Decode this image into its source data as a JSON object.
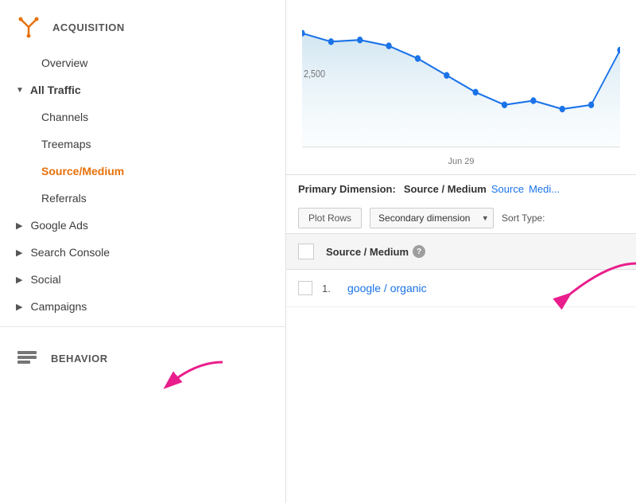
{
  "sidebar": {
    "acquisition_title": "ACQUISITION",
    "items": [
      {
        "id": "overview",
        "label": "Overview",
        "indent": "deep",
        "type": "plain"
      },
      {
        "id": "all-traffic",
        "label": "All Traffic",
        "indent": "medium",
        "type": "subheader",
        "expanded": true
      },
      {
        "id": "channels",
        "label": "Channels",
        "indent": "deep",
        "type": "plain"
      },
      {
        "id": "treemaps",
        "label": "Treemaps",
        "indent": "deep",
        "type": "plain"
      },
      {
        "id": "source-medium",
        "label": "Source/Medium",
        "indent": "deep",
        "type": "active"
      },
      {
        "id": "referrals",
        "label": "Referrals",
        "indent": "deep",
        "type": "plain"
      },
      {
        "id": "google-ads",
        "label": "Google Ads",
        "indent": "medium",
        "type": "expandable"
      },
      {
        "id": "search-console",
        "label": "Search Console",
        "indent": "medium",
        "type": "expandable"
      },
      {
        "id": "social",
        "label": "Social",
        "indent": "medium",
        "type": "expandable"
      },
      {
        "id": "campaigns",
        "label": "Campaigns",
        "indent": "medium",
        "type": "expandable"
      }
    ],
    "behavior_title": "BEHAVIOR"
  },
  "chart": {
    "y_label": "2,500",
    "x_label": "Jun 29"
  },
  "primary_dimension": {
    "label": "Primary Dimension:",
    "options": [
      {
        "id": "source-medium",
        "text": "Source / Medium",
        "selected": true
      },
      {
        "id": "source",
        "text": "Source",
        "selected": false
      },
      {
        "id": "medium",
        "text": "Medi...",
        "selected": false
      }
    ]
  },
  "toolbar": {
    "plot_rows_label": "Plot Rows",
    "secondary_dim_label": "Secondary dimension",
    "sort_type_label": "Sort Type:"
  },
  "table": {
    "header": {
      "column1": "Source / Medium",
      "help_tooltip": "?"
    },
    "rows": [
      {
        "number": "1.",
        "link_text": "google / organic"
      }
    ]
  },
  "arrows": {
    "color": "#e91e8c"
  }
}
